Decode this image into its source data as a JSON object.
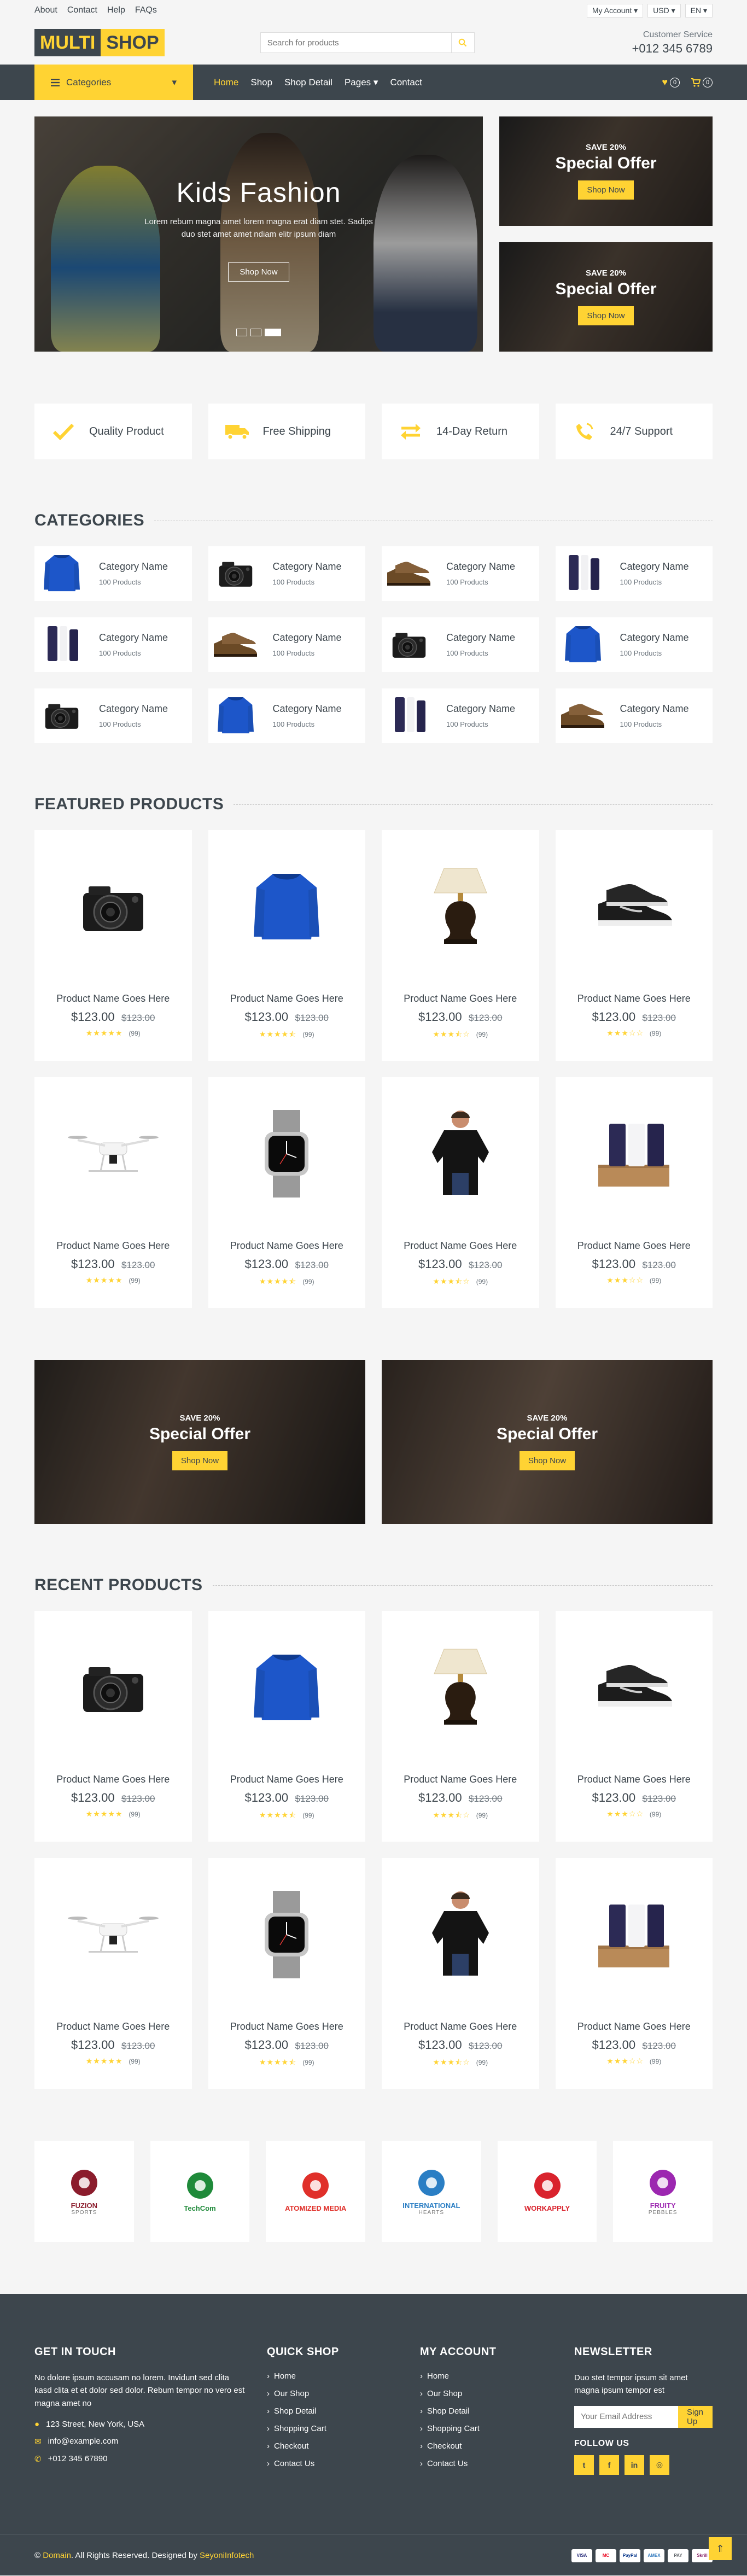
{
  "topbar": {
    "links": [
      "About",
      "Contact",
      "Help",
      "FAQs"
    ],
    "account": "My Account",
    "currency": "USD",
    "language": "EN"
  },
  "header": {
    "logo_part1": "MULTI",
    "logo_part2": "SHOP",
    "search_placeholder": "Search for products",
    "service_label": "Customer Service",
    "service_phone": "+012 345 6789"
  },
  "navbar": {
    "categories_label": "Categories",
    "links": [
      "Home",
      "Shop",
      "Shop Detail",
      "Pages",
      "Contact"
    ],
    "wishlist_count": "0",
    "cart_count": "0"
  },
  "hero": {
    "title": "Kids Fashion",
    "text": "Lorem rebum magna amet lorem magna erat diam stet. Sadips duo stet amet amet ndiam elitr ipsum diam",
    "button": "Shop Now",
    "offers": [
      {
        "save": "SAVE 20%",
        "title": "Special Offer",
        "button": "Shop Now"
      },
      {
        "save": "SAVE 20%",
        "title": "Special Offer",
        "button": "Shop Now"
      }
    ]
  },
  "features": [
    "Quality Product",
    "Free Shipping",
    "14-Day Return",
    "24/7 Support"
  ],
  "categories": {
    "title": "CATEGORIES",
    "items": [
      {
        "name": "Category Name",
        "count": "100 Products",
        "icon": "sweater"
      },
      {
        "name": "Category Name",
        "count": "100 Products",
        "icon": "camera"
      },
      {
        "name": "Category Name",
        "count": "100 Products",
        "icon": "shoes"
      },
      {
        "name": "Category Name",
        "count": "100 Products",
        "icon": "cosmetics"
      },
      {
        "name": "Category Name",
        "count": "100 Products",
        "icon": "cosmetics"
      },
      {
        "name": "Category Name",
        "count": "100 Products",
        "icon": "shoes"
      },
      {
        "name": "Category Name",
        "count": "100 Products",
        "icon": "camera"
      },
      {
        "name": "Category Name",
        "count": "100 Products",
        "icon": "sweater"
      },
      {
        "name": "Category Name",
        "count": "100 Products",
        "icon": "camera"
      },
      {
        "name": "Category Name",
        "count": "100 Products",
        "icon": "sweater"
      },
      {
        "name": "Category Name",
        "count": "100 Products",
        "icon": "cosmetics"
      },
      {
        "name": "Category Name",
        "count": "100 Products",
        "icon": "shoes"
      }
    ]
  },
  "featured": {
    "title": "FEATURED PRODUCTS",
    "items": [
      {
        "name": "Product Name Goes Here",
        "price": "$123.00",
        "old": "$123.00",
        "rating": 5,
        "reviews": "(99)",
        "icon": "camera"
      },
      {
        "name": "Product Name Goes Here",
        "price": "$123.00",
        "old": "$123.00",
        "rating": 4.5,
        "reviews": "(99)",
        "icon": "sweater"
      },
      {
        "name": "Product Name Goes Here",
        "price": "$123.00",
        "old": "$123.00",
        "rating": 3.5,
        "reviews": "(99)",
        "icon": "lamp"
      },
      {
        "name": "Product Name Goes Here",
        "price": "$123.00",
        "old": "$123.00",
        "rating": 3,
        "reviews": "(99)",
        "icon": "sneakers"
      },
      {
        "name": "Product Name Goes Here",
        "price": "$123.00",
        "old": "$123.00",
        "rating": 5,
        "reviews": "(99)",
        "icon": "drone"
      },
      {
        "name": "Product Name Goes Here",
        "price": "$123.00",
        "old": "$123.00",
        "rating": 4.5,
        "reviews": "(99)",
        "icon": "watch"
      },
      {
        "name": "Product Name Goes Here",
        "price": "$123.00",
        "old": "$123.00",
        "rating": 3.5,
        "reviews": "(99)",
        "icon": "blouse"
      },
      {
        "name": "Product Name Goes Here",
        "price": "$123.00",
        "old": "$123.00",
        "rating": 3,
        "reviews": "(99)",
        "icon": "cosmetics-box"
      }
    ]
  },
  "mid_offers": [
    {
      "save": "SAVE 20%",
      "title": "Special Offer",
      "button": "Shop Now"
    },
    {
      "save": "SAVE 20%",
      "title": "Special Offer",
      "button": "Shop Now"
    }
  ],
  "recent": {
    "title": "RECENT PRODUCTS",
    "items": [
      {
        "name": "Product Name Goes Here",
        "price": "$123.00",
        "old": "$123.00",
        "rating": 5,
        "reviews": "(99)",
        "icon": "camera"
      },
      {
        "name": "Product Name Goes Here",
        "price": "$123.00",
        "old": "$123.00",
        "rating": 4.5,
        "reviews": "(99)",
        "icon": "sweater"
      },
      {
        "name": "Product Name Goes Here",
        "price": "$123.00",
        "old": "$123.00",
        "rating": 3.5,
        "reviews": "(99)",
        "icon": "lamp"
      },
      {
        "name": "Product Name Goes Here",
        "price": "$123.00",
        "old": "$123.00",
        "rating": 3,
        "reviews": "(99)",
        "icon": "sneakers"
      },
      {
        "name": "Product Name Goes Here",
        "price": "$123.00",
        "old": "$123.00",
        "rating": 5,
        "reviews": "(99)",
        "icon": "drone"
      },
      {
        "name": "Product Name Goes Here",
        "price": "$123.00",
        "old": "$123.00",
        "rating": 4.5,
        "reviews": "(99)",
        "icon": "watch"
      },
      {
        "name": "Product Name Goes Here",
        "price": "$123.00",
        "old": "$123.00",
        "rating": 3.5,
        "reviews": "(99)",
        "icon": "blouse"
      },
      {
        "name": "Product Name Goes Here",
        "price": "$123.00",
        "old": "$123.00",
        "rating": 3,
        "reviews": "(99)",
        "icon": "cosmetics-box"
      }
    ]
  },
  "vendors": [
    {
      "name": "FUZION",
      "sub": "SPORTS",
      "color": "#8b1c2c"
    },
    {
      "name": "TechCom",
      "sub": "",
      "color": "#1f8a3a"
    },
    {
      "name": "ATOMIZED MEDIA",
      "sub": "",
      "color": "#e0302a"
    },
    {
      "name": "INTERNATIONAL",
      "sub": "HEARTS",
      "color": "#2a7ec4"
    },
    {
      "name": "WORKAPPLY",
      "sub": "",
      "color": "#d9232d"
    },
    {
      "name": "FRUITY",
      "sub": "PEBBLES",
      "color": "#9c27b0"
    }
  ],
  "footer": {
    "get_in_touch": {
      "title": "GET IN TOUCH",
      "text": "No dolore ipsum accusam no lorem. Invidunt sed clita kasd clita et et dolor sed dolor. Rebum tempor no vero est magna amet no",
      "address": "123 Street, New York, USA",
      "email": "info@example.com",
      "phone": "+012 345 67890"
    },
    "quick_shop": {
      "title": "QUICK SHOP",
      "links": [
        "Home",
        "Our Shop",
        "Shop Detail",
        "Shopping Cart",
        "Checkout",
        "Contact Us"
      ]
    },
    "my_account": {
      "title": "MY ACCOUNT",
      "links": [
        "Home",
        "Our Shop",
        "Shop Detail",
        "Shopping Cart",
        "Checkout",
        "Contact Us"
      ]
    },
    "newsletter": {
      "title": "NEWSLETTER",
      "text": "Duo stet tempor ipsum sit amet magna ipsum tempor est",
      "placeholder": "Your Email Address",
      "button": "Sign Up",
      "follow": "FOLLOW US"
    },
    "copyright_prefix": "©",
    "brand": "Domain",
    "copyright_mid": ". All Rights Reserved. Designed by",
    "designer": "SeyoniInfotech",
    "payments": [
      "VISA",
      "MC",
      "PayPal",
      "AMEX",
      "PAY",
      "Skrill"
    ]
  },
  "colors": {
    "accent": "#ffd333",
    "dark": "#3d464d",
    "bg": "#f5f5f5"
  }
}
